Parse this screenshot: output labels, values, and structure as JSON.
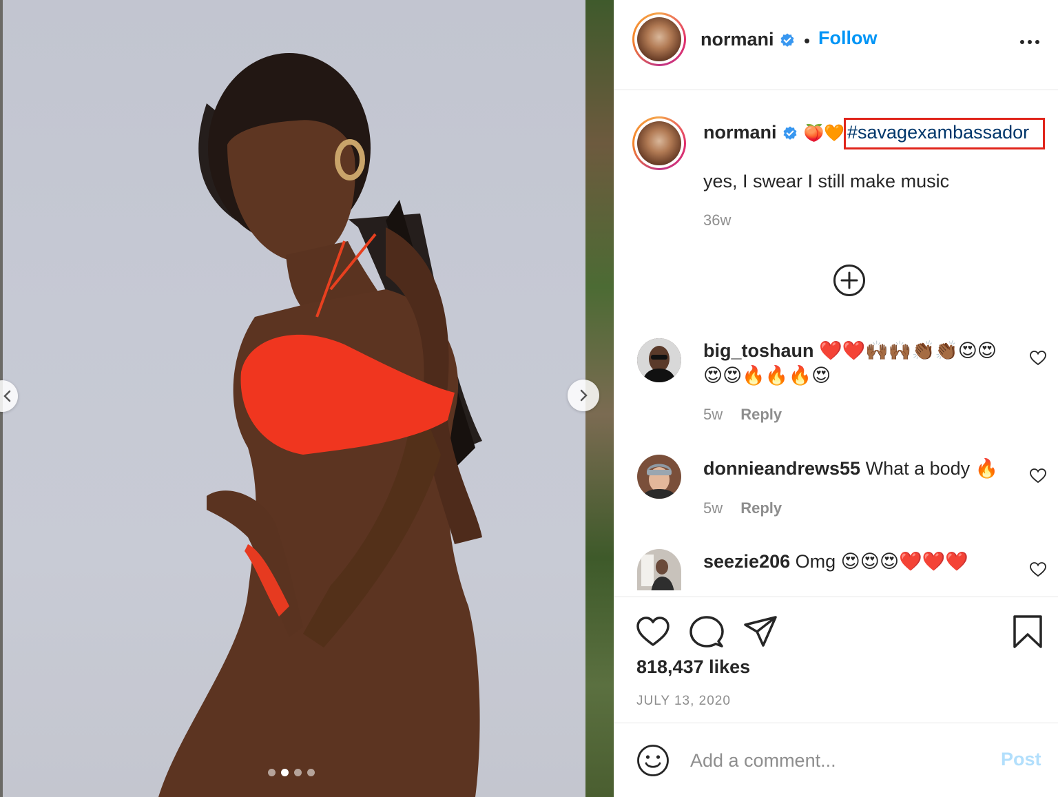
{
  "post": {
    "username": "normani",
    "follow_separator": "•",
    "follow_label": "Follow",
    "caption_emoji": "🍑🧡",
    "hashtag": "#savagexambassador",
    "caption_text": "yes, I swear I still make music",
    "caption_time": "36w",
    "likes": "818,437 likes",
    "date": "JULY 13, 2020",
    "carousel_slides": 4,
    "carousel_active_index": 1
  },
  "comments": [
    {
      "username": "big_toshaun",
      "text": "❤️❤️🙌🏾🙌🏾👏🏾👏🏾😍😍😍😍🔥🔥🔥😍",
      "time": "5w",
      "reply_label": "Reply"
    },
    {
      "username": "donnieandrews55",
      "text": "What a body 🔥",
      "time": "5w",
      "reply_label": "Reply"
    },
    {
      "username": "seezie206",
      "text": "Omg 😍😍😍❤️❤️❤️",
      "time": "",
      "reply_label": ""
    }
  ],
  "composer": {
    "placeholder": "Add a comment...",
    "post_label": "Post"
  },
  "colors": {
    "link": "#0095f6",
    "hashtag": "#00376b",
    "highlight_box": "#e0251b",
    "muted": "#8e8e8e",
    "post_disabled": "#b2dffc"
  },
  "icons": {
    "verified": "verified-badge-icon",
    "more": "more-options-icon",
    "load_more": "plus-circle-icon",
    "like": "heart-icon",
    "comment": "comment-bubble-icon",
    "share": "paper-plane-icon",
    "save": "bookmark-icon",
    "emoji": "emoji-smile-icon",
    "prev": "chevron-left-icon",
    "next": "chevron-right-icon"
  }
}
